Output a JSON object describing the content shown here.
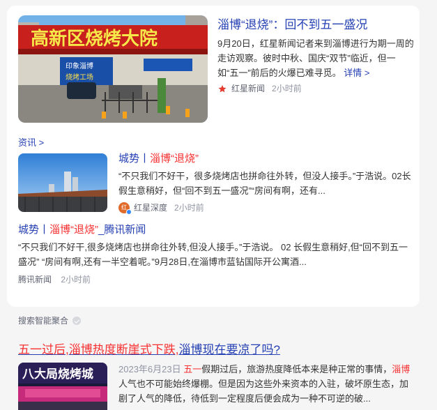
{
  "top_article": {
    "title_pre": "淄博",
    "title_post": "“退烧”：回不到五一盛况",
    "desc": "9月20日，红星新闻记者来到淄博进行为期一周的走访观察。彼时中秋、国庆“双节”临近，但一如“五一”前后的火爆已难寻觅。",
    "more_label": "详情 >",
    "source": "红星新闻",
    "time": "2小时前",
    "image_sign": "高新区烧烤大院",
    "image_banner_1": "印象淄博",
    "image_banner_2": "烧烤工场"
  },
  "section_link": "资讯 >",
  "mid_article": {
    "title_pre": "城势丨",
    "title_hl": "淄博“退烧”",
    "desc": "“不只我们不好干，很多烧烤店也拼命往外转，但没人接手。”于浩说。02长假生意稍好，但“回不到五一盛况”“房间有啊，还有...",
    "source": "红星深度",
    "time": "2小时前",
    "avatar_text": "红"
  },
  "third_article": {
    "title_pre": "城势丨",
    "title_hl": "淄博“退烧”",
    "title_post": "_腾讯新闻",
    "desc": "“不只我们不好干,很多烧烤店也拼命往外转,但没人接手。”于浩说。 02 长假生意稍好,但“回不到五一盛况” “房间有啊,还有一半空着呢。”9月28日,在淄博市蓝钻国际开公寓酒...",
    "source": "腾讯新闻",
    "time": "2小时前"
  },
  "aggregation_label": "搜索智能聚合",
  "bottom_result": {
    "title_part1": "五一过后,",
    "title_part2": "淄博热度断崖式下跌,",
    "title_part3": "淄博现在要凉了吗?",
    "date": "2023年6月23日",
    "desc_hl1": "五一",
    "desc_mid": "假期过后，旅游热度降低本来是种正常的事情，",
    "desc_hl2": "淄博",
    "desc_post": "人气也不可能始终爆棚。但是因为这些外来资本的入驻，破坏原生态，加剧了人气的降低，待低到一定程度后便会成为一种不可逆的破...",
    "image_sign": "八大局烧烤城"
  }
}
